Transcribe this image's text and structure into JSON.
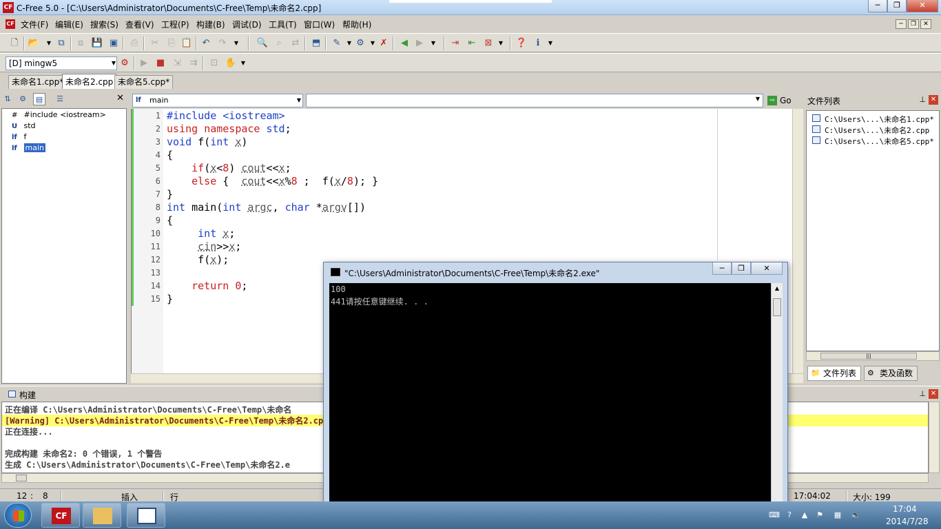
{
  "window": {
    "title": "C-Free 5.0 - [C:\\Users\\Administrator\\Documents\\C-Free\\Temp\\未命名2.cpp]",
    "app_logo": "CF"
  },
  "menu": [
    "文件(F)",
    "编辑(E)",
    "搜索(S)",
    "查看(V)",
    "工程(P)",
    "构建(B)",
    "调试(D)",
    "工具(T)",
    "窗口(W)",
    "帮助(H)"
  ],
  "toolbar": {
    "compiler": "[D] mingw5"
  },
  "file_tabs": [
    {
      "label": "未命名1.cpp*",
      "active": false
    },
    {
      "label": "未命名2.cpp",
      "active": true
    },
    {
      "label": "未命名5.cpp*",
      "active": false
    }
  ],
  "symbols": [
    {
      "icon": "#",
      "label": "#include <iostream>"
    },
    {
      "icon": "U",
      "label": "std"
    },
    {
      "icon": "f",
      "label": "f"
    },
    {
      "icon": "f",
      "label": "main"
    }
  ],
  "editor": {
    "function_selector": "main",
    "go_label": "Go",
    "line_numbers": [
      "1",
      "2",
      "3",
      "4",
      "5",
      "6",
      "7",
      "8",
      "9",
      "10",
      "11",
      "12",
      "13",
      "14",
      "15"
    ]
  },
  "right_panel": {
    "title": "文件列表",
    "files": [
      "C:\\Users\\...\\未命名1.cpp*",
      "C:\\Users\\...\\未命名2.cpp",
      "C:\\Users\\...\\未命名5.cpp*"
    ],
    "tabs": [
      "文件列表",
      "类及函数"
    ]
  },
  "build": {
    "title": "构建",
    "lines": [
      "正在编译 C:\\Users\\Administrator\\Documents\\C-Free\\Temp\\未命名",
      "[Warning] C:\\Users\\Administrator\\Documents\\C-Free\\Temp\\未命名2.cpp:",
      "正在连接...",
      "",
      "完成构建 未命名2: 0 个错误, 1 个警告",
      "生成 C:\\Users\\Administrator\\Documents\\C-Free\\Temp\\未命名2.e"
    ]
  },
  "status": {
    "line": "12",
    "col": "8",
    "mode": "插入",
    "row_label": "行",
    "time": "17:04:02",
    "size": "大小: 199"
  },
  "console": {
    "title": "\"C:\\Users\\Administrator\\Documents\\C-Free\\Temp\\未命名2.exe\"",
    "lines": [
      "100",
      "441请按任意键继续. . ."
    ]
  },
  "taskbar": {
    "time": "17:04",
    "date": "2014/7/28"
  }
}
